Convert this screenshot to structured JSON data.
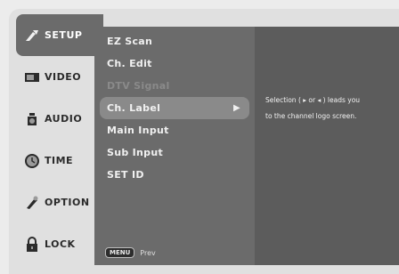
{
  "sidebar": {
    "items": [
      {
        "label": "SETUP",
        "icon": "setup-icon"
      },
      {
        "label": "VIDEO",
        "icon": "video-icon"
      },
      {
        "label": "AUDIO",
        "icon": "audio-icon"
      },
      {
        "label": "TIME",
        "icon": "time-icon"
      },
      {
        "label": "OPTION",
        "icon": "option-icon"
      },
      {
        "label": "LOCK",
        "icon": "lock-icon"
      }
    ],
    "active_index": 0
  },
  "menu": {
    "items": [
      {
        "label": "EZ Scan",
        "state": "normal"
      },
      {
        "label": "Ch. Edit",
        "state": "normal"
      },
      {
        "label": "DTV Signal",
        "state": "disabled"
      },
      {
        "label": "Ch. Label",
        "state": "selected"
      },
      {
        "label": "Main Input",
        "state": "normal"
      },
      {
        "label": "Sub Input",
        "state": "normal"
      },
      {
        "label": "SET ID",
        "state": "normal"
      }
    ],
    "footer_key": "MENU",
    "footer_label": "Prev"
  },
  "info": {
    "line1": "Selection ( ▸ or ◂ ) leads you",
    "line2": "to the channel logo screen."
  },
  "colors": {
    "background": "#ececec",
    "menu_bg": "#6b6b6b",
    "info_bg": "#5c5c5c",
    "highlight": "#8a8a8a"
  }
}
